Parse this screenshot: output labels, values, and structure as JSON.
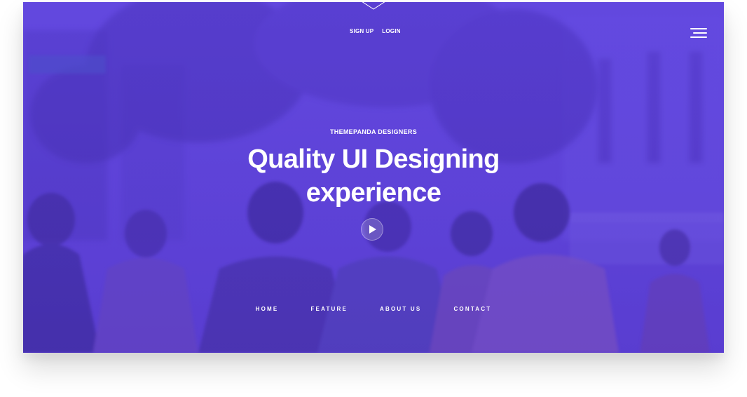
{
  "header": {
    "signup_label": "SIGN UP",
    "login_label": "LOGIN",
    "menu_icon": "hamburger-menu-icon"
  },
  "hero": {
    "eyebrow": "THEMEPANDA DESIGNERS",
    "headline_line1": "Quality UI Designing",
    "headline_line2": "experience",
    "play_icon": "play-icon",
    "overlay_color": "#5a3fd6"
  },
  "nav": {
    "items": [
      {
        "label": "HOME"
      },
      {
        "label": "FEATURE"
      },
      {
        "label": "ABOUT US"
      },
      {
        "label": "CONTACT"
      }
    ]
  }
}
